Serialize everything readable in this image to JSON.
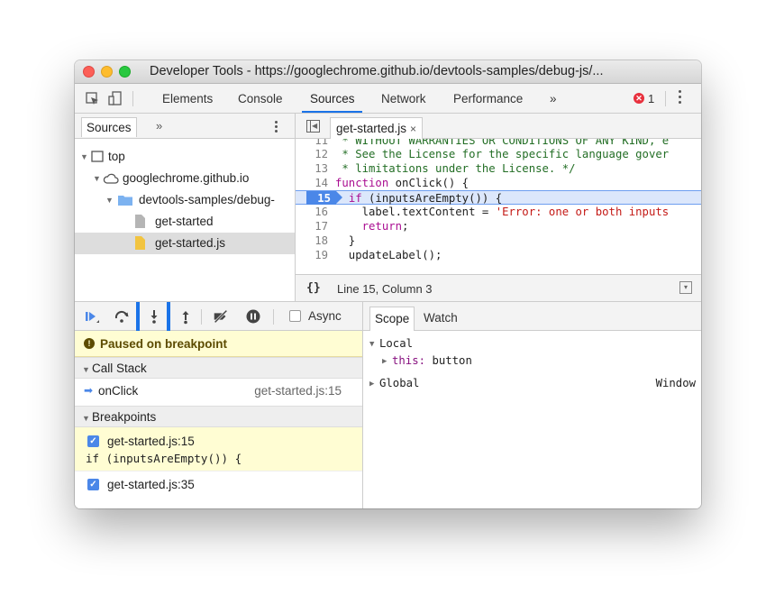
{
  "window": {
    "title": "Developer Tools - https://googlechrome.github.io/devtools-samples/debug-js/..."
  },
  "main_toolbar": {
    "tabs": [
      "Elements",
      "Console",
      "Sources",
      "Network",
      "Performance"
    ],
    "active_tab": "Sources",
    "more": "»",
    "error_count": "1"
  },
  "navigator": {
    "tab": "Sources",
    "more": "»",
    "tree": [
      {
        "label": "top",
        "type": "frame",
        "expanded": true
      },
      {
        "label": "googlechrome.github.io",
        "type": "domain",
        "expanded": true
      },
      {
        "label": "devtools-samples/debug-",
        "type": "folder",
        "expanded": true
      },
      {
        "label": "get-started",
        "type": "file"
      },
      {
        "label": "get-started.js",
        "type": "script-file",
        "selected": true
      }
    ]
  },
  "editor": {
    "tab": "get-started.js",
    "close": "×",
    "lines": [
      {
        "num": "11",
        "text": " * WITHOUT WARRANTIES OR CONDITIONS OF ANY KIND, e"
      },
      {
        "num": "12",
        "text": " * See the License for the specific language gover"
      },
      {
        "num": "13",
        "text": " * limitations under the License. */"
      },
      {
        "num": "14",
        "kw": "function",
        "rest": " onClick() {"
      },
      {
        "num": "15",
        "pre": "  ",
        "kw": "if",
        "rest": " (inputsAreEmpty()) {"
      },
      {
        "num": "16",
        "pre": "    label.textContent = ",
        "str": "'Error: one or both inputs"
      },
      {
        "num": "17",
        "pre": "    ",
        "kw": "return",
        "rest": ";"
      },
      {
        "num": "18",
        "text": "  }"
      },
      {
        "num": "19",
        "text": "  updateLabel();"
      }
    ],
    "breakpoint_line": "15",
    "status": {
      "braces": "{}",
      "position": "Line 15, Column 3"
    }
  },
  "debugger": {
    "async_label": "Async",
    "paused_message": "Paused on breakpoint",
    "call_stack_header": "Call Stack",
    "call_stack": [
      {
        "function": "onClick",
        "location": "get-started.js:15"
      }
    ],
    "breakpoints_header": "Breakpoints",
    "breakpoints": [
      {
        "location": "get-started.js:15",
        "code": "if (inputsAreEmpty()) {",
        "checked": true
      },
      {
        "location": "get-started.js:35",
        "checked": true
      }
    ]
  },
  "sidebar": {
    "tabs": [
      "Scope",
      "Watch"
    ],
    "active_tab": "Scope",
    "scope": {
      "local_label": "Local",
      "this_name": "this",
      "this_value": "button",
      "global_label": "Global",
      "global_value": "Window"
    }
  },
  "colors": {
    "accent": "#1a73e8",
    "breakpoint": "#4b87e8",
    "paused_bg": "#fffdd3",
    "error": "#e8303d"
  }
}
